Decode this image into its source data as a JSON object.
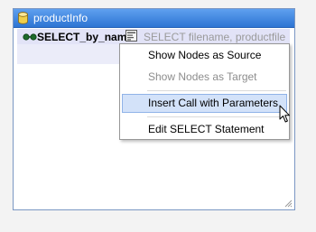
{
  "component": {
    "title": "productInfo",
    "icon": "database-icon",
    "row": {
      "name": "SELECT_by_name",
      "icon": "glasses-icon",
      "sql_icon": "sql-statement-icon",
      "sql_text": "SELECT filename, productfile"
    }
  },
  "context_menu": {
    "items": [
      {
        "label": "Show Nodes as Source",
        "state": "enabled"
      },
      {
        "label": "Show Nodes as Target",
        "state": "disabled"
      },
      {
        "label": "Insert Call with Parameters",
        "state": "highlighted"
      },
      {
        "label": "Edit SELECT Statement",
        "state": "enabled"
      }
    ]
  },
  "colors": {
    "titlebar": "#2d74d3",
    "row_highlight": "#e2e3f7",
    "menu_highlight": "#d3e2f9",
    "menu_highlight_border": "#90b3e8"
  }
}
